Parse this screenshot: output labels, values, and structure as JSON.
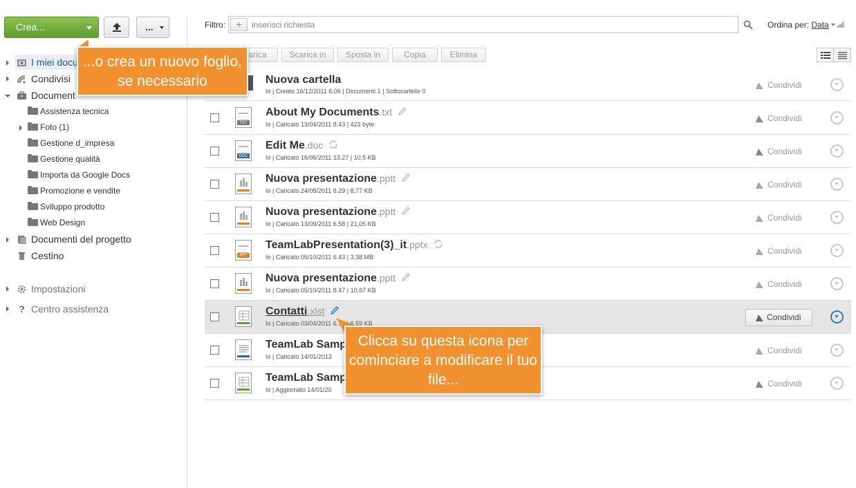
{
  "toolbar": {
    "create_label": "Crea...",
    "more_label": "..."
  },
  "sidebar": {
    "my_docs": "I miei docu",
    "shared": "Condivisi",
    "documents": "Document",
    "folders": [
      "Assistenza tecnica",
      "Foto (1)",
      "Gestione d_impresa",
      "Gestione qualità",
      "Importa da Google Docs",
      "Promozione e vendite",
      "Sviluppo prodotto",
      "Web Design"
    ],
    "project_docs": "Documenti del progetto",
    "trash": "Cestino",
    "settings": "Impostazioni",
    "help": "Centro assistenza"
  },
  "filter": {
    "label": "Filtro:",
    "placeholder": "inserisci richiesta",
    "sort_label": "Ordina per:",
    "sort_value": "Data"
  },
  "actions": [
    "arica",
    "Scarica in",
    "Sposta in",
    "Copia",
    "Elimina"
  ],
  "files": [
    {
      "name": "Nuova cartella",
      "ext": "",
      "meta": "Io | Creato 16/12/2011 6.06 | Documenti 1 | Sottocartelle 0",
      "share": "Condividi",
      "type": "folder",
      "action": "none"
    },
    {
      "name": "About My Documents",
      "ext": ".txt",
      "meta": "Io | Caricato 13/04/2011 8.43 | 423 byte",
      "share": "Condividi",
      "type": "txt",
      "action": "edit"
    },
    {
      "name": "Edit Me",
      "ext": ".doc",
      "meta": "Io | Caricato 16/06/2011 13.27 | 10,5 KB",
      "share": "Condividi",
      "type": "doc",
      "action": "convert"
    },
    {
      "name": "Nuova presentazione",
      "ext": ".pptt",
      "meta": "Io | Caricato 24/08/2011 8.29 | 8,77 KB",
      "share": "Condividi",
      "type": "pres",
      "action": "edit"
    },
    {
      "name": "Nuova presentazione",
      "ext": ".pptt",
      "meta": "Io | Caricato 13/09/2011 6.58 | 21,05 KB",
      "share": "Condividi",
      "type": "pres",
      "action": "edit"
    },
    {
      "name": "TeamLabPresentation(3)_it",
      "ext": ".pptx",
      "meta": "Io | Caricato 05/10/2011 6.43 | 3,38 MB",
      "share": "Condividi",
      "type": "ppt",
      "action": "convert"
    },
    {
      "name": "Nuova presentazione",
      "ext": ".pptt",
      "meta": "Io | Caricato 05/10/2011 8.47 | 10,67 KB",
      "share": "Condividi",
      "type": "pres",
      "action": "edit"
    },
    {
      "name": "Contatti",
      "ext": ".xlst",
      "meta": "Io | Caricato 03/04/2011 6.15 | 6,59 KB",
      "share": "Condividi",
      "type": "sheet",
      "action": "edit-active"
    },
    {
      "name": "TeamLab Samp",
      "ext": "",
      "meta": "Io | Caricato 14/01/2013",
      "share": "Condividi",
      "type": "textdoc",
      "action": "none"
    },
    {
      "name": "TeamLab Samp",
      "ext": "",
      "meta": "Io | Aggiornato 14/01/20",
      "share": "Condividi",
      "type": "sheet",
      "action": "none"
    }
  ],
  "tooltips": {
    "create": "...o crea un nuovo foglio, se necessario",
    "edit": "Clicca su questa icona per cominciare a modificare il tuo file..."
  },
  "colors": {
    "accent_green": "#6aa83a",
    "tooltip_orange": "#f2912f",
    "link_blue": "#1f5d86"
  }
}
